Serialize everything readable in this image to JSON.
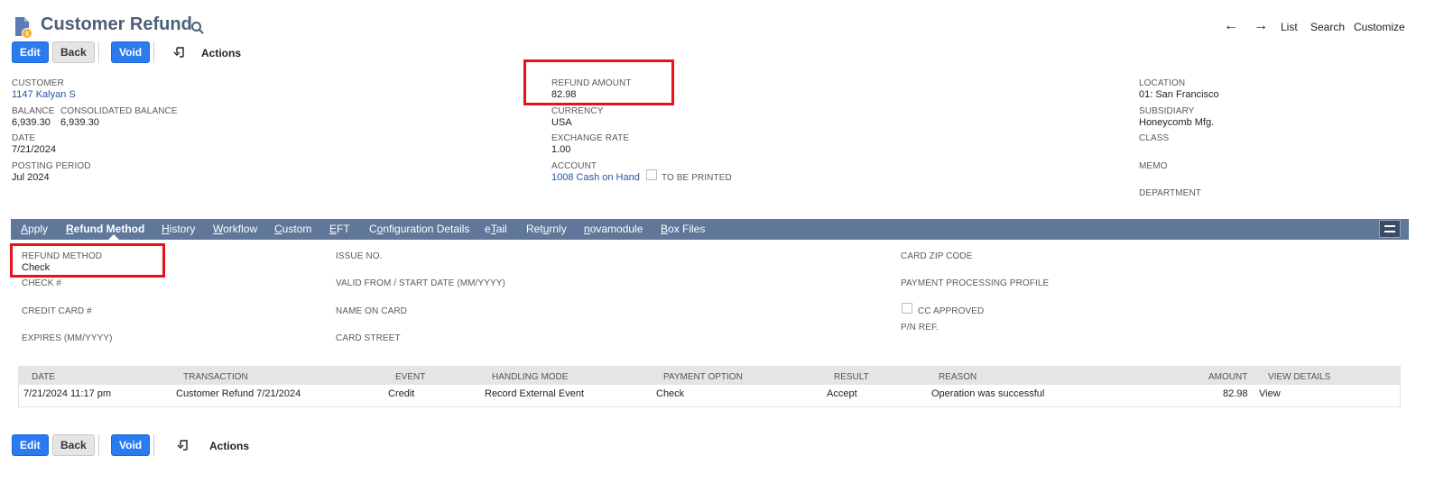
{
  "header": {
    "title": "Customer Refund",
    "nav": {
      "list": "List",
      "search": "Search",
      "customize": "Customize",
      "prev_arrow": "←",
      "next_arrow": "→"
    }
  },
  "toolbar": {
    "edit": "Edit",
    "back": "Back",
    "void": "Void",
    "actions": "Actions"
  },
  "primary": {
    "customer_label": "CUSTOMER",
    "customer_value": "1147 Kalyan S",
    "balance_label": "BALANCE",
    "balance_value": "6,939.30",
    "consolidated_label": "CONSOLIDATED BALANCE",
    "consolidated_value": "6,939.30",
    "date_label": "DATE",
    "date_value": "7/21/2024",
    "posting_period_label": "POSTING PERIOD",
    "posting_period_value": "Jul 2024",
    "refund_amount_label": "REFUND AMOUNT",
    "refund_amount_value": "82.98",
    "currency_label": "CURRENCY",
    "currency_value": "USA",
    "exchange_rate_label": "EXCHANGE RATE",
    "exchange_rate_value": "1.00",
    "account_label": "ACCOUNT",
    "account_value": "1008 Cash on Hand",
    "to_be_printed_label": "TO BE PRINTED",
    "location_label": "LOCATION",
    "location_value": "01: San Francisco",
    "subsidiary_label": "SUBSIDIARY",
    "subsidiary_value": "Honeycomb Mfg.",
    "class_label": "CLASS",
    "memo_label": "MEMO",
    "department_label": "DEPARTMENT"
  },
  "tabs": [
    {
      "pre": "",
      "u": "A",
      "post": "pply"
    },
    {
      "pre": "",
      "u": "R",
      "post": "efund Method"
    },
    {
      "pre": "",
      "u": "H",
      "post": "istory"
    },
    {
      "pre": "",
      "u": "W",
      "post": "orkflow"
    },
    {
      "pre": "",
      "u": "C",
      "post": "ustom"
    },
    {
      "pre": "",
      "u": "E",
      "post": "FT"
    },
    {
      "pre": "C",
      "u": "o",
      "post": "nfiguration Details"
    },
    {
      "pre": "e",
      "u": "T",
      "post": "ail"
    },
    {
      "pre": "Ret",
      "u": "u",
      "post": "rnly"
    },
    {
      "pre": "",
      "u": "n",
      "post": "ovamodule"
    },
    {
      "pre": "",
      "u": "B",
      "post": "ox Files"
    }
  ],
  "refund_method": {
    "method_label": "REFUND METHOD",
    "method_value": "Check",
    "check_label": "CHECK #",
    "credit_card_label": "CREDIT CARD #",
    "expires_label": "EXPIRES (MM/YYYY)",
    "issue_no_label": "ISSUE NO.",
    "valid_from_label": "VALID FROM / START DATE (MM/YYYY)",
    "name_on_card_label": "NAME ON CARD",
    "card_street_label": "CARD STREET",
    "card_zip_label": "CARD ZIP CODE",
    "processing_profile_label": "PAYMENT PROCESSING PROFILE",
    "cc_approved_label": "CC APPROVED",
    "pn_ref_label": "P/N REF."
  },
  "table": {
    "headers": [
      "DATE",
      "TRANSACTION",
      "EVENT",
      "HANDLING MODE",
      "PAYMENT OPTION",
      "RESULT",
      "REASON",
      "AMOUNT",
      "VIEW DETAILS"
    ],
    "rows": [
      [
        "7/21/2024 11:17 pm",
        "Customer Refund 7/21/2024",
        "Credit",
        "Record External Event",
        "Check",
        "Accept",
        "Operation was successful",
        "82.98",
        "View"
      ]
    ]
  }
}
